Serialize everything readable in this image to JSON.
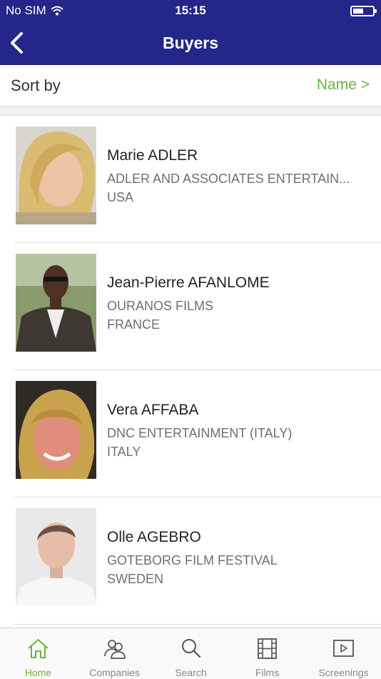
{
  "status_bar": {
    "carrier": "No SIM",
    "time": "15:15"
  },
  "nav": {
    "title": "Buyers"
  },
  "sort": {
    "label": "Sort by",
    "value": "Name >"
  },
  "buyers": [
    {
      "name": "Marie ADLER",
      "company": "ADLER AND ASSOCIATES ENTERTAIN...",
      "country": "USA"
    },
    {
      "name": "Jean-Pierre AFANLOME",
      "company": "OURANOS FILMS",
      "country": "FRANCE"
    },
    {
      "name": "Vera AFFABA",
      "company": "DNC ENTERTAINMENT (ITALY)",
      "country": "ITALY"
    },
    {
      "name": "Olle AGEBRO",
      "company": "GOTEBORG FILM FESTIVAL",
      "country": "SWEDEN"
    }
  ],
  "tabs": [
    {
      "label": "Home",
      "icon": "home-icon",
      "active": true
    },
    {
      "label": "Companies",
      "icon": "companies-icon",
      "active": false
    },
    {
      "label": "Search",
      "icon": "search-icon",
      "active": false
    },
    {
      "label": "Films",
      "icon": "film-icon",
      "active": false
    },
    {
      "label": "Screenings",
      "icon": "play-icon",
      "active": false
    }
  ],
  "colors": {
    "header": "#24268a",
    "accent": "#6db33f"
  }
}
